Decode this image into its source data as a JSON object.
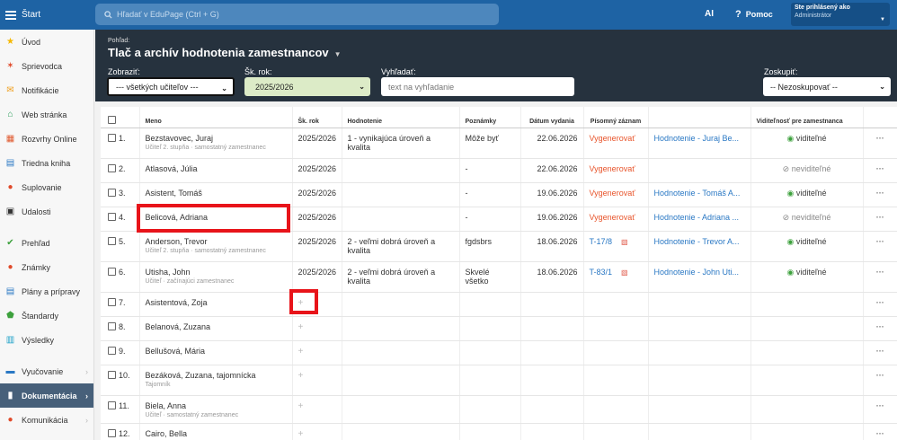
{
  "topbar": {
    "start_label": "Štart",
    "search_placeholder": "Hľadať v EduPage (Ctrl + G)",
    "ai_label": "AI",
    "help_label": "Pomoc",
    "user_line1": "Ste prihlásený ako",
    "user_line2": "Administrátor"
  },
  "sidebar": {
    "items": [
      {
        "label": "Úvod",
        "icon": "star-icon",
        "color": "#f5b800"
      },
      {
        "label": "Sprievodca",
        "icon": "wand-icon",
        "color": "#e04a2a"
      },
      {
        "label": "Notifikácie",
        "icon": "envelope-icon",
        "color": "#f0a020"
      },
      {
        "label": "Web stránka",
        "icon": "home-icon",
        "color": "#2a9d5a"
      },
      {
        "label": "Rozvrhy Online",
        "icon": "timetable-icon",
        "color": "#e05a30"
      },
      {
        "label": "Triedna kniha",
        "icon": "book-icon",
        "color": "#2a78c4"
      },
      {
        "label": "Suplovanie",
        "icon": "person-icon",
        "color": "#e04a2a"
      },
      {
        "label": "Udalosti",
        "icon": "calendar-icon",
        "color": "#333333"
      },
      {
        "label": "Prehľad",
        "icon": "check-circle-icon",
        "color": "#3da13d"
      },
      {
        "label": "Známky",
        "icon": "grades-icon",
        "color": "#e04a2a"
      },
      {
        "label": "Plány a prípravy",
        "icon": "plans-icon",
        "color": "#2a78c4"
      },
      {
        "label": "Štandardy",
        "icon": "shield-check-icon",
        "color": "#3da13d"
      },
      {
        "label": "Výsledky",
        "icon": "bar-chart-icon",
        "color": "#1aa0c8"
      },
      {
        "label": "Vyučovanie",
        "icon": "teaching-icon",
        "color": "#2a78c4"
      },
      {
        "label": "Dokumentácia",
        "icon": "document-icon",
        "color": "#ffffff"
      },
      {
        "label": "Komunikácia",
        "icon": "chat-icon",
        "color": "#e04a2a"
      }
    ]
  },
  "header": {
    "view_label": "Pohľad:",
    "title": "Tlač a archív hodnotenia zamestnancov",
    "filters": {
      "show_label": "Zobraziť:",
      "show_value": "--- všetkých učiteľov ---",
      "year_label": "Šk. rok:",
      "year_value": "2025/2026",
      "search_label": "Vyhľadať:",
      "search_placeholder": "text na vyhľadanie",
      "group_label": "Zoskupiť:",
      "group_value": "-- Nezoskupovať --"
    }
  },
  "table": {
    "headers": {
      "name": "Meno",
      "year": "Šk. rok",
      "evaluation": "Hodnotenie",
      "notes": "Poznámky",
      "date": "Dátum vydania",
      "record": "Písomný záznam",
      "visibility": "Viditeľnosť pre zamestnanca"
    },
    "rows": [
      {
        "num": "1.",
        "name": "Bezstavovec, Juraj",
        "sub": "Učiteľ 2. stupňa · samostatný zamestnanec",
        "year": "2025/2026",
        "eval": "1 - vynikajúca úroveň a kvalita",
        "notes": "Môže byť",
        "date": "22.06.2026",
        "record": "Vygenerovať",
        "record_type": "generate",
        "link": "Hodnotenie - Juraj Be...",
        "visibility": "viditeľné",
        "visible": true
      },
      {
        "num": "2.",
        "name": "Atlasová, Júlia",
        "sub": "",
        "year": "2025/2026",
        "eval": "",
        "notes": "-",
        "date": "22.06.2026",
        "record": "Vygenerovať",
        "record_type": "generate",
        "link": "",
        "visibility": "neviditeľné",
        "visible": false
      },
      {
        "num": "3.",
        "name": "Asistent, Tomáš",
        "sub": "",
        "year": "2025/2026",
        "eval": "",
        "notes": "-",
        "date": "19.06.2026",
        "record": "Vygenerovať",
        "record_type": "generate",
        "link": "Hodnotenie - Tomáš A...",
        "visibility": "viditeľné",
        "visible": true
      },
      {
        "num": "4.",
        "name": "Belicová, Adriana",
        "sub": "",
        "year": "2025/2026",
        "eval": "",
        "notes": "-",
        "date": "19.06.2026",
        "record": "Vygenerovať",
        "record_type": "generate",
        "link": "Hodnotenie - Adriana ...",
        "visibility": "neviditeľné",
        "visible": false
      },
      {
        "num": "5.",
        "name": "Anderson, Trevor",
        "sub": "Učiteľ 2. stupňa · samostatný zamestnanec",
        "year": "2025/2026",
        "eval": "2 - veľmi dobrá úroveň a kvalita",
        "notes": "fgdsbrs",
        "date": "18.06.2026",
        "record": "T-17/8",
        "record_type": "file",
        "link": "Hodnotenie - Trevor A...",
        "visibility": "viditeľné",
        "visible": true
      },
      {
        "num": "6.",
        "name": "Utisha, John",
        "sub": "Učiteľ · začínajúci zamestnanec",
        "year": "2025/2026",
        "eval": "2 - veľmi dobrá úroveň a kvalita",
        "notes": "Skvelé všetko",
        "date": "18.06.2026",
        "record": "T-83/1",
        "record_type": "file",
        "link": "Hodnotenie - John Uti...",
        "visibility": "viditeľné",
        "visible": true
      },
      {
        "num": "7.",
        "name": "Asistentová, Zoja",
        "sub": "",
        "empty": true
      },
      {
        "num": "8.",
        "name": "Belanová, Zuzana",
        "sub": "",
        "empty": true
      },
      {
        "num": "9.",
        "name": "Bellušová, Mária",
        "sub": "",
        "empty": true
      },
      {
        "num": "10.",
        "name": "Bezáková, Zuzana, tajomnícka",
        "sub": "Tajomník",
        "empty": true
      },
      {
        "num": "11.",
        "name": "Biela, Anna",
        "sub": "Učiteľ · samostatný zamestnanec",
        "empty": true
      },
      {
        "num": "12.",
        "name": "Cairo, Bella",
        "sub": "",
        "empty": true
      }
    ],
    "more_label": "···",
    "plus_label": "+"
  },
  "colors": {
    "topbar": "#1e63a4",
    "header": "#26323e",
    "sidebar_active": "#47607a",
    "generate": "#e8542b",
    "link": "#2a78c4",
    "visible": "#3da13d",
    "highlight": "#e8141a"
  }
}
